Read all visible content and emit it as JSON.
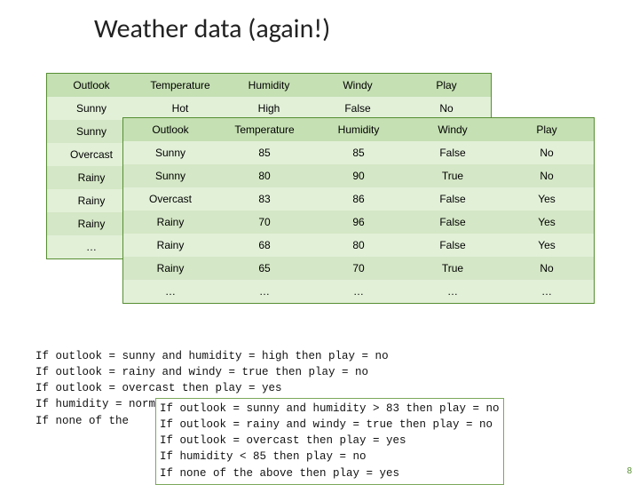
{
  "title": "Weather data (again!)",
  "table_a": {
    "headers": [
      "Outlook",
      "Temperature",
      "Humidity",
      "Windy",
      "Play"
    ],
    "rows": [
      [
        "Sunny",
        "Hot",
        "High",
        "False",
        "No"
      ],
      [
        "Sunny",
        "",
        "",
        "",
        ""
      ],
      [
        "Overcast",
        "",
        "",
        "",
        ""
      ],
      [
        "Rainy",
        "",
        "",
        "",
        ""
      ],
      [
        "Rainy",
        "",
        "",
        "",
        ""
      ],
      [
        "Rainy",
        "",
        "",
        "",
        ""
      ],
      [
        "…",
        "",
        "",
        "",
        ""
      ]
    ]
  },
  "table_b": {
    "headers": [
      "Outlook",
      "Temperature",
      "Humidity",
      "Windy",
      "Play"
    ],
    "rows": [
      [
        "Sunny",
        "85",
        "85",
        "False",
        "No"
      ],
      [
        "Sunny",
        "80",
        "90",
        "True",
        "No"
      ],
      [
        "Overcast",
        "83",
        "86",
        "False",
        "Yes"
      ],
      [
        "Rainy",
        "70",
        "96",
        "False",
        "Yes"
      ],
      [
        "Rainy",
        "68",
        "80",
        "False",
        "Yes"
      ],
      [
        "Rainy",
        "65",
        "70",
        "True",
        "No"
      ],
      [
        "…",
        "…",
        "…",
        "…",
        "…"
      ]
    ]
  },
  "rules_a": [
    "If outlook = sunny and humidity = high then play = no",
    "If outlook = rainy and windy = true then play = no",
    "If outlook = overcast then play = yes",
    "If humidity = normal then play = yes",
    "If none of the"
  ],
  "rules_b": [
    "If outlook = sunny and humidity > 83 then play = no",
    "If outlook = rainy and windy = true then play = no",
    "If outlook = overcast then play = yes",
    "If humidity < 85 then play = no",
    "If none of the above then play = yes"
  ],
  "page_number": "8"
}
